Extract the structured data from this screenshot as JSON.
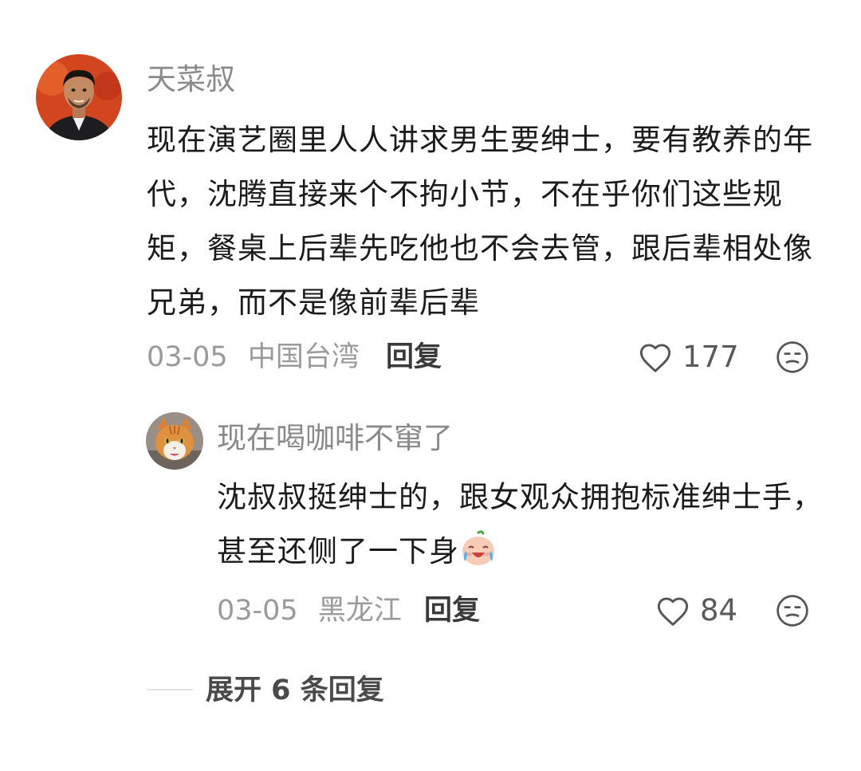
{
  "comment": {
    "username": "天菜叔",
    "avatar_icon": "man-portrait-avatar",
    "text": "现在演艺圈里人人讲求男生要绅士，要有教养的年代，沈腾直接来个不拘小节，不在乎你们这些规矩，餐桌上后辈先吃他也不会去管，跟后辈相处像兄弟，而不是像前辈后辈",
    "date": "03-05",
    "location": "中国台湾",
    "reply_label": "回复",
    "like_count": "177",
    "like_icon": "heart-outline-icon",
    "dislike_icon": "sad-face-icon"
  },
  "reply": {
    "username": "现在喝咖啡不窜了",
    "avatar_icon": "orange-cat-avatar",
    "text": "沈叔叔挺绅士的，跟女观众拥抱标准绅士手，甚至还侧了一下身",
    "emoji_icon": "crying-laughing-sticker-icon",
    "date": "03-05",
    "location": "黑龙江",
    "reply_label": "回复",
    "like_count": "84",
    "like_icon": "heart-outline-icon",
    "dislike_icon": "sad-face-icon"
  },
  "expand": {
    "label": "展开 6 条回复"
  },
  "colors": {
    "username": "#8a8a8a",
    "text": "#1b1b1b",
    "meta": "#9a9a9a",
    "icon": "#555555"
  }
}
